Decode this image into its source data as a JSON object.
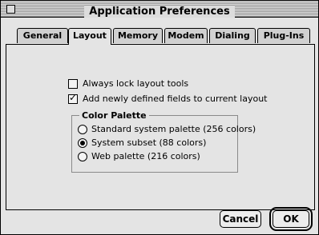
{
  "window": {
    "title": "Application Preferences"
  },
  "tabs": [
    "General",
    "Layout",
    "Memory",
    "Modem",
    "Dialing",
    "Plug-Ins"
  ],
  "active_tab": "Layout",
  "layout": {
    "checkboxes": [
      {
        "label": "Always lock layout tools",
        "checked": false
      },
      {
        "label": "Add newly defined fields to current layout",
        "checked": true
      }
    ],
    "color_palette": {
      "title": "Color Palette",
      "options": [
        {
          "label": "Standard system palette (256 colors)",
          "selected": false
        },
        {
          "label": "System subset (88 colors)",
          "selected": true
        },
        {
          "label": "Web palette (216 colors)",
          "selected": false
        }
      ]
    }
  },
  "buttons": {
    "cancel": "Cancel",
    "ok": "OK"
  }
}
